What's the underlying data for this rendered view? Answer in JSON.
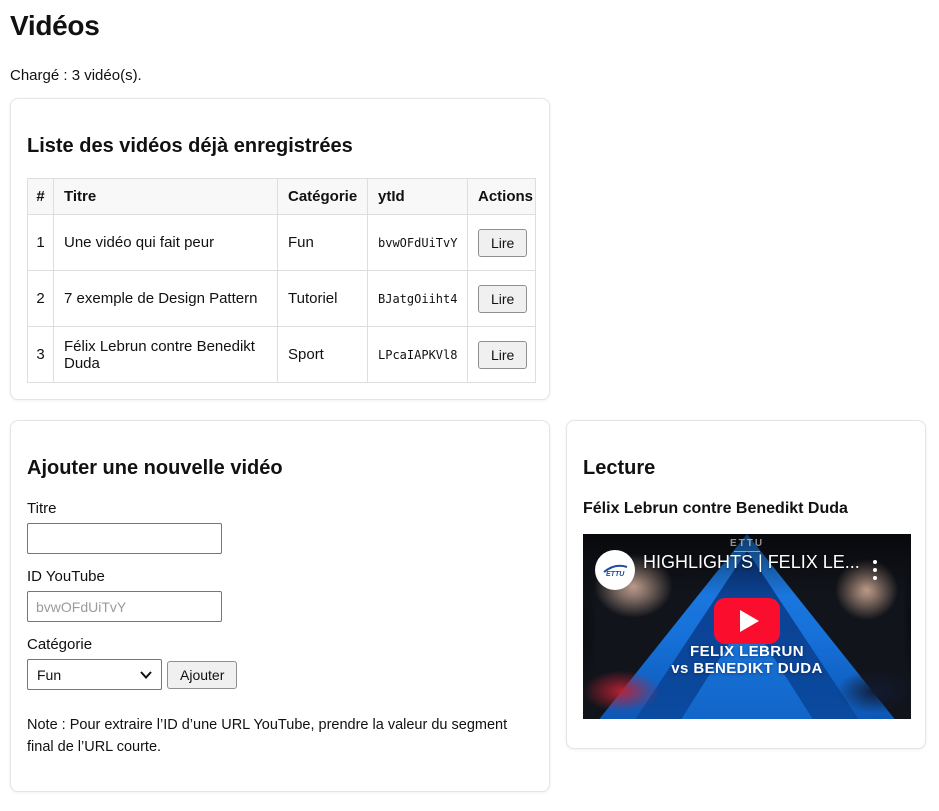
{
  "page": {
    "title": "Vidéos",
    "status": "Chargé : 3 vidéo(s)."
  },
  "list_card": {
    "title": "Liste des vidéos déjà enregistrées",
    "columns": [
      "#",
      "Titre",
      "Catégorie",
      "ytId",
      "Actions"
    ],
    "action_label": "Lire",
    "rows": [
      {
        "num": "1",
        "titre": "Une vidéo qui fait peur",
        "categorie": "Fun",
        "ytid": "bvwOFdUiTvY"
      },
      {
        "num": "2",
        "titre": "7 exemple de Design Pattern",
        "categorie": "Tutoriel",
        "ytid": "BJatgOiiht4"
      },
      {
        "num": "3",
        "titre": "Félix Lebrun contre Benedikt Duda",
        "categorie": "Sport",
        "ytid": "LPcaIAPKVl8"
      }
    ]
  },
  "form_card": {
    "title": "Ajouter une nouvelle vidéo",
    "titre_label": "Titre",
    "titre_value": "",
    "ytid_label": "ID YouTube",
    "ytid_placeholder": "bvwOFdUiTvY",
    "categorie_label": "Catégorie",
    "categorie_value": "Fun",
    "submit_label": "Ajouter",
    "note": "Note : Pour extraire l’ID d’une URL YouTube, prendre la valeur du segment final de l’URL courte."
  },
  "player_card": {
    "title": "Lecture",
    "video_title": "Félix Lebrun contre Benedikt Duda",
    "thumbnail": {
      "overlay_title": "HIGHLIGHTS | FELIX LE...",
      "channel": "ETTU",
      "caption_line1": "FELIX LEBRUN",
      "caption_line2": "vs BENEDIKT DUDA"
    }
  },
  "colors": {
    "accent_blue": "#1671d9",
    "accent_blue_dark": "#0a4aa0",
    "play_red": "#fb0d2e",
    "card_border": "#e4e4e4",
    "table_border": "#dedede",
    "thead_bg": "#f8f8f8",
    "button_bg": "#f0f0f0",
    "button_border": "#8f8f8f",
    "input_border": "#767676",
    "placeholder": "#9b9b9b"
  }
}
